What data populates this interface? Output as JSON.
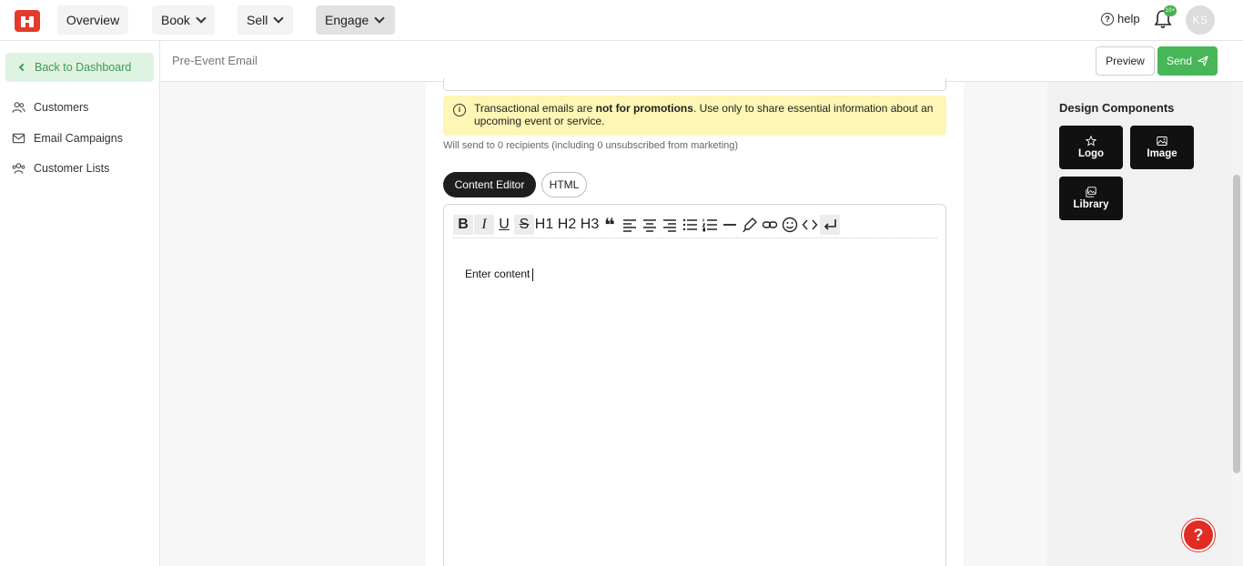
{
  "nav": {
    "overview": "Overview",
    "book": "Book",
    "sell": "Sell",
    "engage": "Engage",
    "help": "help",
    "notif_badge": "10+",
    "avatar_initials": "KS"
  },
  "sidebar": {
    "back": "Back to Dashboard",
    "items": [
      {
        "label": "Customers",
        "icon": "users-icon"
      },
      {
        "label": "Email Campaigns",
        "icon": "mail-icon"
      },
      {
        "label": "Customer Lists",
        "icon": "users-list-icon"
      }
    ]
  },
  "subheader": {
    "title": "Pre-Event Email",
    "preview": "Preview",
    "send": "Send"
  },
  "notice": {
    "before": "Transactional emails are ",
    "bold": "not for promotions",
    "after": ". Use only to share essential information about an upcoming event or service."
  },
  "recipients": "Will send to 0 recipients (including 0 unsubscribed from marketing)",
  "tabs": {
    "content_editor": "Content Editor",
    "html": "HTML"
  },
  "editor": {
    "toolbar": {
      "bold": "B",
      "italic": "I",
      "underline": "U",
      "strike": "S",
      "h1": "H1",
      "h2": "H2",
      "h3": "H3",
      "quote": "❝"
    },
    "content": "Enter content"
  },
  "design_components": {
    "title": "Design Components",
    "items": [
      "Logo",
      "Image",
      "Library"
    ]
  },
  "colors": {
    "brand": "#e33b2a",
    "accent_green": "#46b657",
    "notice_bg": "#fdf6b4"
  },
  "fab": "?"
}
